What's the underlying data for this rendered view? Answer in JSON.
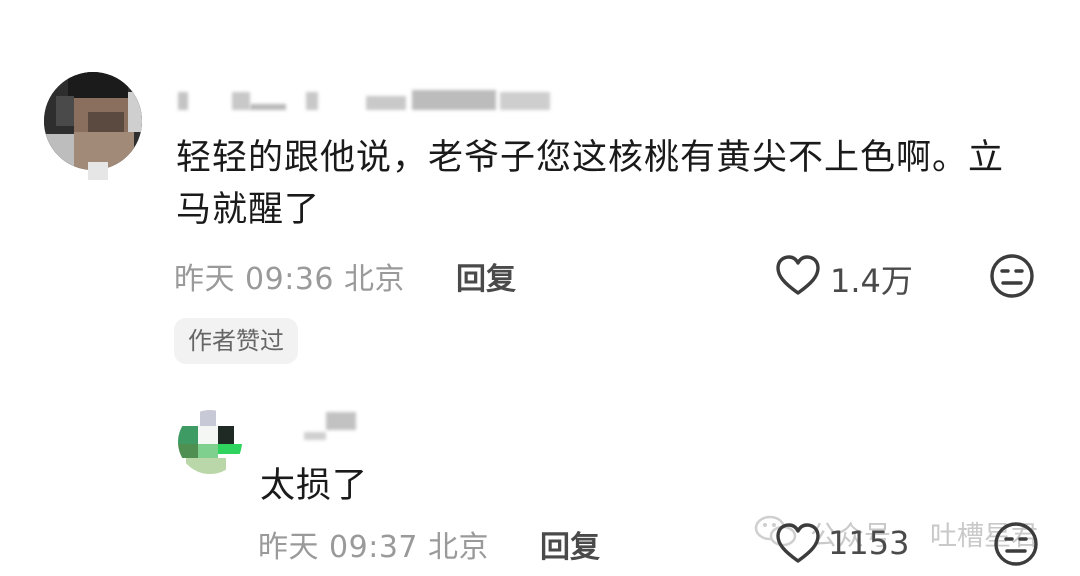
{
  "comments": [
    {
      "text_line1": "轻轻的跟他说，老爷子您这核桃有黄尖不上色啊。立",
      "text_line2": "马就醒了",
      "time": "昨天 09:36 北京",
      "reply_label": "回复",
      "like_count": "1.4万",
      "badge": "作者赞过"
    },
    {
      "text": "太损了",
      "time": "昨天 09:37 北京",
      "reply_label": "回复",
      "like_count": "1153"
    }
  ],
  "watermark": {
    "text1": "公众号",
    "text2": "吐槽星君",
    "icon": "wechat-icon"
  },
  "icons": {
    "like": "heart-outline-icon",
    "dislike": "neutral-face-icon"
  },
  "colors": {
    "text": "#1a1a1a",
    "meta": "#9a9a9a",
    "icon": "#3c3c3c"
  }
}
